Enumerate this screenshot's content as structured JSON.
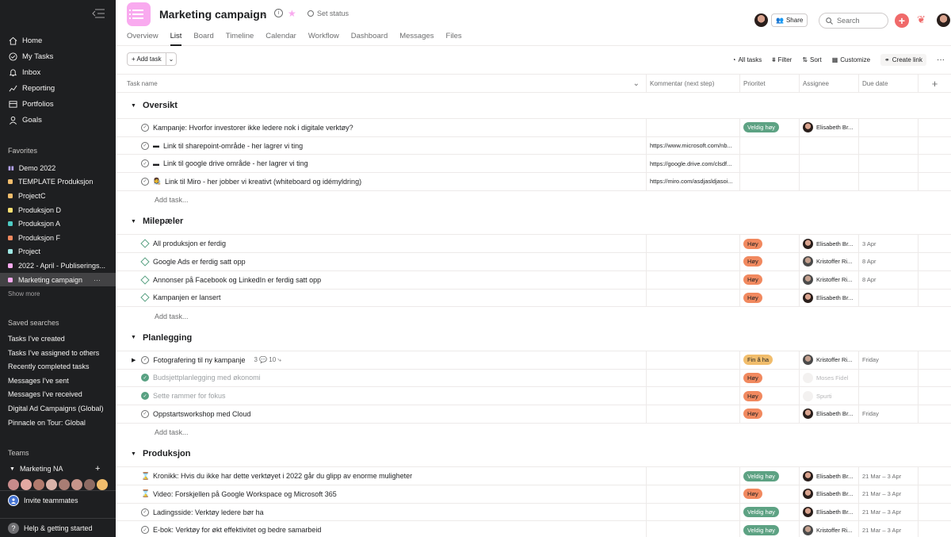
{
  "sidebar": {
    "nav": [
      {
        "label": "Home",
        "icon": "home-icon"
      },
      {
        "label": "My Tasks",
        "icon": "check-circle-icon"
      },
      {
        "label": "Inbox",
        "icon": "bell-icon"
      },
      {
        "label": "Reporting",
        "icon": "chart-line-icon"
      },
      {
        "label": "Portfolios",
        "icon": "folder-icon"
      },
      {
        "label": "Goals",
        "icon": "person-icon"
      }
    ],
    "favorites_title": "Favorites",
    "favorites": [
      {
        "label": "Demo 2022",
        "color": "#b6a4f5"
      },
      {
        "label": "TEMPLATE Produksjon",
        "color": "#f1bd6c"
      },
      {
        "label": "ProjectC",
        "color": "#f1bd6c"
      },
      {
        "label": "Produksjon D",
        "color": "#f8df72"
      },
      {
        "label": "Produksjon A",
        "color": "#4ecbc4"
      },
      {
        "label": "Produksjon F",
        "color": "#f1895f"
      },
      {
        "label": "Project",
        "color": "#9ee7e3"
      },
      {
        "label": "2022 - April - Publiserings...",
        "color": "#f9aaef"
      },
      {
        "label": "Marketing campaign",
        "color": "#f9aaef"
      }
    ],
    "favorite_more": "···",
    "show_more": "Show more",
    "saved_title": "Saved searches",
    "saved": [
      "Tasks I've created",
      "Tasks I've assigned to others",
      "Recently completed tasks",
      "Messages I've sent",
      "Messages I've received",
      "Digital Ad Campaigns (Global)",
      "Pinnacle on Tour: Global"
    ],
    "teams_title": "Teams",
    "team_name": "Marketing NA",
    "team_add": "+",
    "invite": "Invite teammates",
    "help": "Help & getting started",
    "help_icon": "?"
  },
  "header": {
    "title": "Marketing campaign",
    "set_status": "Set status",
    "share": "Share",
    "search_placeholder": "Search",
    "create_plus": "+",
    "tabs": [
      "Overview",
      "List",
      "Board",
      "Timeline",
      "Calendar",
      "Workflow",
      "Dashboard",
      "Messages",
      "Files"
    ]
  },
  "toolbar": {
    "add_task": "+ Add task",
    "all_tasks": "All tasks",
    "filter": "Filter",
    "sort": "Sort",
    "customize": "Customize",
    "create_link": "Create link",
    "more": "···"
  },
  "columns": {
    "name": "Task name",
    "comment": "Kommentar (next step)",
    "priority": "Prioritet",
    "assignee": "Assignee",
    "due": "Due date",
    "add": "+"
  },
  "add_task_label": "Add task...",
  "sections": [
    {
      "title": "Oversikt",
      "rows": [
        {
          "icon": "check",
          "name": "Kampanje: Hvorfor investorer ikke ledere nok i digitale verktøy?",
          "comment": "",
          "priority": "Veldig høy",
          "prio_class": "b-vh",
          "assignee": "Elisabeth Br...",
          "due": ""
        },
        {
          "icon": "check",
          "prefix": "▬",
          "name": "Link til sharepoint-område - her lagrer vi ting",
          "comment": "https://www.microsoft.com/nb...",
          "priority": "",
          "assignee": "",
          "due": ""
        },
        {
          "icon": "check",
          "prefix": "▬",
          "name": "Link til google drive område - her lagrer vi ting",
          "comment": "https://google.drive.com/clsdf...",
          "priority": "",
          "assignee": "",
          "due": ""
        },
        {
          "icon": "check",
          "prefix": "👩‍🎨",
          "name": "Link til Miro - her jobber vi kreativt (whiteboard og idémyldring)",
          "comment": "https://miro.com/asdjasldjasoi...",
          "priority": "",
          "assignee": "",
          "due": ""
        }
      ]
    },
    {
      "title": "Milepæler",
      "rows": [
        {
          "icon": "diamond",
          "name": "All produksjon er ferdig",
          "comment": "",
          "priority": "Høy",
          "prio_class": "b-h",
          "assignee": "Elisabeth Br...",
          "due": "3 Apr"
        },
        {
          "icon": "diamond",
          "name": "Google Ads er ferdig satt opp",
          "comment": "",
          "priority": "Høy",
          "prio_class": "b-h",
          "assignee": "Kristoffer Ri...",
          "due": "8 Apr"
        },
        {
          "icon": "diamond",
          "name": "Annonser på Facebook og LinkedIn er ferdig satt opp",
          "comment": "",
          "priority": "Høy",
          "prio_class": "b-h",
          "assignee": "Kristoffer Ri...",
          "due": "8 Apr"
        },
        {
          "icon": "diamond",
          "name": "Kampanjen er lansert",
          "comment": "",
          "priority": "Høy",
          "prio_class": "b-h",
          "assignee": "Elisabeth Br...",
          "due": ""
        }
      ]
    },
    {
      "title": "Planlegging",
      "rows": [
        {
          "icon": "check",
          "expand": "▶",
          "name": "Fotografering til ny kampanje",
          "sub": "3 💬   10 ⤷",
          "comment": "",
          "priority": "Fin å ha",
          "prio_class": "b-f",
          "assignee": "Kristoffer Ri...",
          "due": "Friday"
        },
        {
          "icon": "done",
          "name": "Budsjettplanlegging med økonomi",
          "comment": "",
          "priority": "Høy",
          "prio_class": "b-h",
          "assignee": "Moses Fidel",
          "faded": true,
          "due": ""
        },
        {
          "icon": "done",
          "name": "Sette rammer for fokus",
          "comment": "",
          "priority": "Høy",
          "prio_class": "b-h",
          "assignee": "Spurti",
          "faded": true,
          "due": ""
        },
        {
          "icon": "check",
          "name": "Oppstartsworkshop med Cloud",
          "comment": "",
          "priority": "Høy",
          "prio_class": "b-h",
          "assignee": "Elisabeth Br...",
          "due": "Friday"
        }
      ]
    },
    {
      "title": "Produksjon",
      "rows": [
        {
          "icon": "hourglass",
          "name": "Kronikk: Hvis du ikke har dette verktøyet i 2022 går du glipp av enorme muligheter",
          "comment": "",
          "priority": "Veldig høy",
          "prio_class": "b-vh",
          "assignee": "Elisabeth Br...",
          "due": "21 Mar – 3 Apr"
        },
        {
          "icon": "hourglass",
          "name": "Video: Forskjellen på Google Workspace og Microsoft 365",
          "comment": "",
          "priority": "Høy",
          "prio_class": "b-h",
          "assignee": "Elisabeth Br...",
          "due": "21 Mar – 3 Apr"
        },
        {
          "icon": "check",
          "name": "Ladingsside: Verktøy ledere bør ha",
          "comment": "",
          "priority": "Veldig høy",
          "prio_class": "b-vh",
          "assignee": "Elisabeth Br...",
          "due": "21 Mar – 3 Apr"
        },
        {
          "icon": "check",
          "name": "E-bok: Verktøy for økt effektivitet og bedre samarbeid",
          "comment": "",
          "priority": "Veldig høy",
          "prio_class": "b-vh",
          "assignee": "Kristoffer Ri...",
          "due": "21 Mar – 3 Apr"
        }
      ]
    }
  ]
}
